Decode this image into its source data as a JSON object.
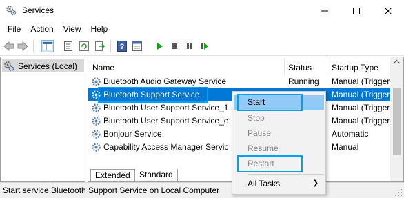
{
  "window": {
    "title": "Services"
  },
  "menu": [
    "File",
    "Action",
    "View",
    "Help"
  ],
  "toolbar_icons": [
    "back-icon",
    "forward-icon",
    "show-hide-tree-icon",
    "properties-icon",
    "refresh-icon",
    "export-list-icon",
    "help-icon",
    "console-icon",
    "start-service-icon",
    "stop-service-icon",
    "pause-service-icon",
    "restart-service-icon"
  ],
  "tree": {
    "item": "Services (Local)"
  },
  "columns": {
    "name": "Name",
    "status": "Status",
    "startup": "Startup Type"
  },
  "rows": [
    {
      "name": "Bluetooth Audio Gateway Service",
      "status": "Running",
      "startup": "Manual (Trigger"
    },
    {
      "name": "Bluetooth Support Service",
      "status": "",
      "startup": "Manual (Trigger",
      "selected": true
    },
    {
      "name": "Bluetooth User Support Service_1",
      "status": "",
      "startup": "Manual (Trigger"
    },
    {
      "name": "Bluetooth User Support Service_e",
      "status": "",
      "startup": "Manual (Trigger"
    },
    {
      "name": "Bonjour Service",
      "status": "",
      "startup": "Automatic"
    },
    {
      "name": "Capability Access Manager Servic",
      "status": "",
      "startup": "Manual"
    }
  ],
  "tabs": {
    "extended": "Extended",
    "standard": "Standard"
  },
  "status": "Start service Bluetooth Support Service on Local Computer",
  "context_menu": {
    "start": "Start",
    "stop": "Stop",
    "pause": "Pause",
    "resume": "Resume",
    "restart": "Restart",
    "all_tasks": "All Tasks"
  },
  "colors": {
    "selection": "#0078d7",
    "callout": "#00a2e8",
    "menu_hover": "#91c9f7"
  }
}
